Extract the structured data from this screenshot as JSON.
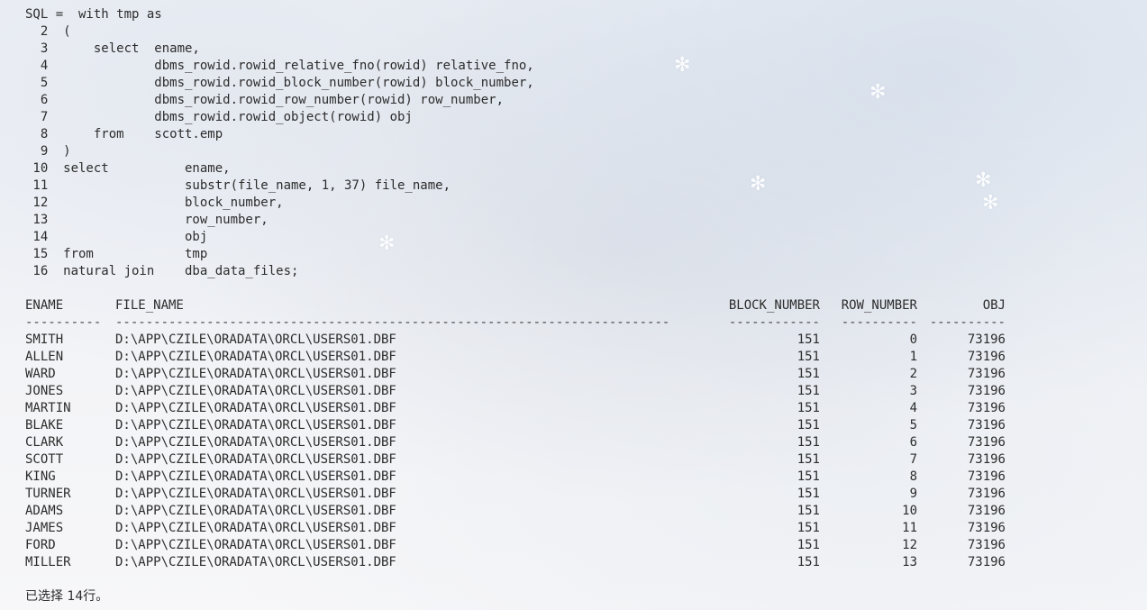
{
  "sql_lines": [
    "SQL =  with tmp as",
    "  2  (",
    "  3      select  ename,",
    "  4              dbms_rowid.rowid_relative_fno(rowid) relative_fno,",
    "  5              dbms_rowid.rowid_block_number(rowid) block_number,",
    "  6              dbms_rowid.rowid_row_number(rowid) row_number,",
    "  7              dbms_rowid.rowid_object(rowid) obj",
    "  8      from    scott.emp",
    "  9  )",
    " 10  select          ename,",
    " 11                  substr(file_name, 1, 37) file_name,",
    " 12                  block_number,",
    " 13                  row_number,",
    " 14                  obj",
    " 15  from            tmp",
    " 16  natural join    dba_data_files;"
  ],
  "result": {
    "headers": [
      "ENAME",
      "FILE_NAME",
      "BLOCK_NUMBER",
      "ROW_NUMBER",
      "OBJ"
    ],
    "separators": [
      "----------",
      "-------------------------------------------------------------------------",
      "------------",
      "----------",
      "----------"
    ],
    "rows": [
      [
        "SMITH",
        "D:\\APP\\CZILE\\ORADATA\\ORCL\\USERS01.DBF",
        "151",
        "0",
        "73196"
      ],
      [
        "ALLEN",
        "D:\\APP\\CZILE\\ORADATA\\ORCL\\USERS01.DBF",
        "151",
        "1",
        "73196"
      ],
      [
        "WARD",
        "D:\\APP\\CZILE\\ORADATA\\ORCL\\USERS01.DBF",
        "151",
        "2",
        "73196"
      ],
      [
        "JONES",
        "D:\\APP\\CZILE\\ORADATA\\ORCL\\USERS01.DBF",
        "151",
        "3",
        "73196"
      ],
      [
        "MARTIN",
        "D:\\APP\\CZILE\\ORADATA\\ORCL\\USERS01.DBF",
        "151",
        "4",
        "73196"
      ],
      [
        "BLAKE",
        "D:\\APP\\CZILE\\ORADATA\\ORCL\\USERS01.DBF",
        "151",
        "5",
        "73196"
      ],
      [
        "CLARK",
        "D:\\APP\\CZILE\\ORADATA\\ORCL\\USERS01.DBF",
        "151",
        "6",
        "73196"
      ],
      [
        "SCOTT",
        "D:\\APP\\CZILE\\ORADATA\\ORCL\\USERS01.DBF",
        "151",
        "7",
        "73196"
      ],
      [
        "KING",
        "D:\\APP\\CZILE\\ORADATA\\ORCL\\USERS01.DBF",
        "151",
        "8",
        "73196"
      ],
      [
        "TURNER",
        "D:\\APP\\CZILE\\ORADATA\\ORCL\\USERS01.DBF",
        "151",
        "9",
        "73196"
      ],
      [
        "ADAMS",
        "D:\\APP\\CZILE\\ORADATA\\ORCL\\USERS01.DBF",
        "151",
        "10",
        "73196"
      ],
      [
        "JAMES",
        "D:\\APP\\CZILE\\ORADATA\\ORCL\\USERS01.DBF",
        "151",
        "11",
        "73196"
      ],
      [
        "FORD",
        "D:\\APP\\CZILE\\ORADATA\\ORCL\\USERS01.DBF",
        "151",
        "12",
        "73196"
      ],
      [
        "MILLER",
        "D:\\APP\\CZILE\\ORADATA\\ORCL\\USERS01.DBF",
        "151",
        "13",
        "73196"
      ]
    ]
  },
  "footer": "已选择 14行。",
  "colors": {
    "text": "#2c2c2c",
    "background": "#f1f3f7"
  }
}
